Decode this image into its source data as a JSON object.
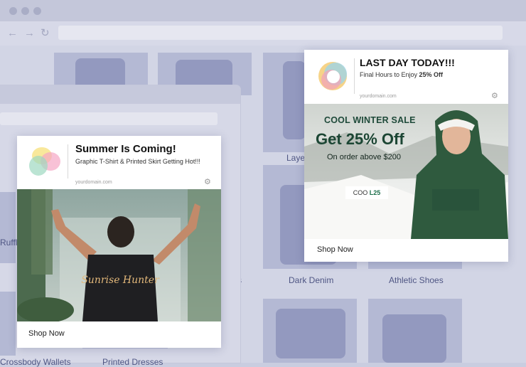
{
  "background_store": {
    "categories": [
      "Layer",
      "Ruffl",
      "Dark Denim",
      "Athletic Shoes",
      "Crossbody Wallets",
      "Printed Dresses",
      "s"
    ]
  },
  "summer_ad": {
    "title": "Summer Is Coming!",
    "subtitle": "Graphic T-Shirt & Printed Skirt Getting Hot!!!",
    "domain": "yourdomain.com",
    "cta": "Shop Now",
    "shirt_text": "Sunrise Hunter"
  },
  "winter_ad": {
    "title": "LAST DAY TODAY!!!",
    "subtitle_prefix": "Final Hours to Enjoy ",
    "subtitle_strong": "25% Off",
    "domain": "yourdomain.com",
    "kicker": "COOL WINTER SALE",
    "headline": "Get 25% Off",
    "order_text": "On order above $200",
    "coupon_prefix": "COO",
    "coupon_code": "L25",
    "cta": "Shop Now"
  },
  "colors": {
    "overlay": "#c9cde0",
    "tile": "#b4b9d4",
    "accent_green": "#1c4634"
  }
}
